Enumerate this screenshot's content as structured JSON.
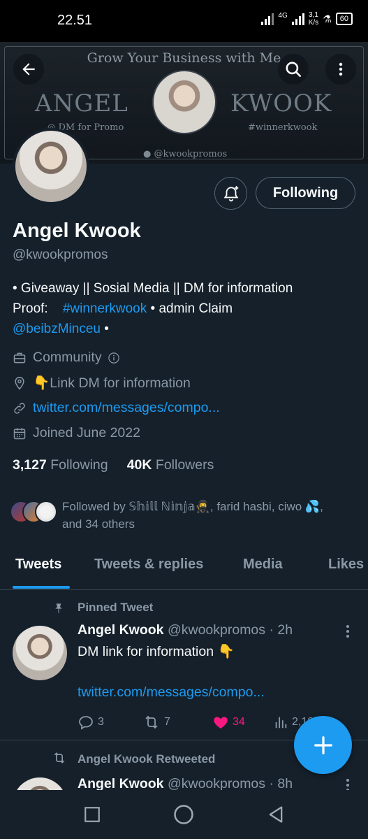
{
  "status_bar": {
    "time": "22.51",
    "network": "4G",
    "speed_value": "3,1",
    "speed_unit": "K/s",
    "battery": "60"
  },
  "banner": {
    "headline": "Grow Your Business with Me",
    "left_word": "ANGEL",
    "right_word": "KWOOK",
    "dm_promo": "DM for Promo",
    "hashtag": "#winnerkwook",
    "twitter_handle": "@kwookpromos"
  },
  "header": {
    "back_icon": "back-arrow-icon",
    "search_icon": "search-icon",
    "more_icon": "more-vertical-icon"
  },
  "profile": {
    "name": "Angel Kwook",
    "handle": "@kwookpromos",
    "following_button": "Following",
    "bio_line1": "• Giveaway || Sosial Media || DM for information",
    "bio_proof": "Proof:",
    "bio_hashtag": "#winnerkwook",
    "bio_admin": " • admin Claim",
    "bio_mention": "@beibzMinceu",
    "bio_end": " •",
    "category": "Community",
    "location": "👇Link DM for information",
    "website": "twitter.com/messages/compo...",
    "joined": "Joined June 2022",
    "following_count": "3,127",
    "following_label": "Following",
    "followers_count": "40K",
    "followers_label": "Followers",
    "followed_by_line1": "Followed by 𝕊𝕙𝕚𝕝𝕝 ℕ𝕚𝕟𝕛𝕒🥷, farid hasbi, ciwo 💦,",
    "followed_by_line2": "and 34 others"
  },
  "tabs": [
    {
      "label": "Tweets",
      "active": true
    },
    {
      "label": "Tweets & replies",
      "active": false
    },
    {
      "label": "Media",
      "active": false
    },
    {
      "label": "Likes",
      "active": false
    }
  ],
  "tweets": [
    {
      "context": "Pinned Tweet",
      "name": "Angel Kwook",
      "handle_time": "@kwookpromos · 2h",
      "text": "DM link for information 👇",
      "link": "twitter.com/messages/compo...",
      "replies": "3",
      "retweets": "7",
      "likes": "34",
      "views": "2,187"
    },
    {
      "context": "Angel Kwook Retweeted",
      "name": "Angel Kwook",
      "handle_time": "@kwookpromos · 8h"
    }
  ],
  "colors": {
    "background": "#15202b",
    "accent": "#1d9bf0",
    "like": "#f91880",
    "muted": "#8b98a5"
  }
}
